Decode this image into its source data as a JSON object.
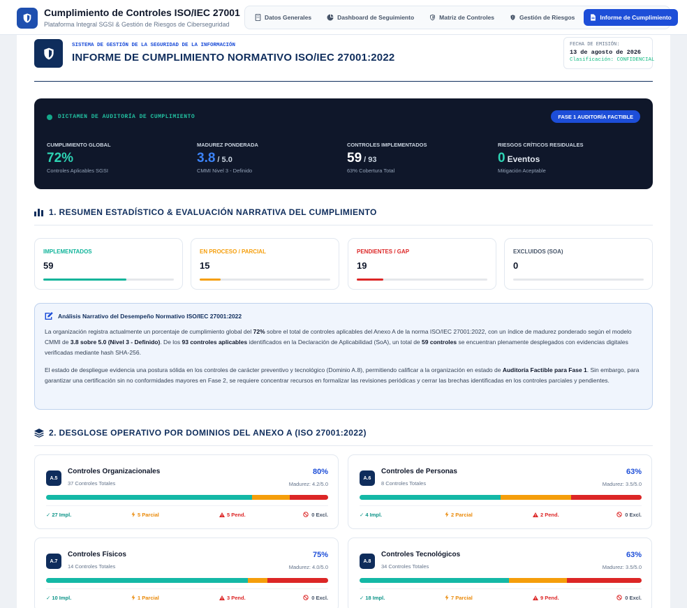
{
  "app": {
    "title": "Cumplimiento de Controles ISO/IEC 27001",
    "subtitle": "Plataforma Integral SGSI & Gestión de Riesgos de Ciberseguridad"
  },
  "nav": [
    {
      "label": "Datos Generales",
      "icon": "building-icon",
      "active": false
    },
    {
      "label": "Dashboard de Seguimiento",
      "icon": "pie-chart-icon",
      "active": false
    },
    {
      "label": "Matriz de Controles",
      "icon": "shield-icon",
      "active": false
    },
    {
      "label": "Gestión de Riesgos",
      "icon": "shield-alert-icon",
      "active": false
    },
    {
      "label": "Informe de Cumplimiento",
      "icon": "document-icon",
      "active": true
    }
  ],
  "report": {
    "kicker": "SISTEMA DE GESTIÓN DE LA SEGURIDAD DE LA INFORMACIÓN",
    "title": "INFORME DE CUMPLIMIENTO NORMATIVO ISO/IEC 27001:2022",
    "emit_label": "FECHA DE EMISIÓN:",
    "emit_date": "13 de agosto de 2026",
    "classification": "Clasificación: CONFIDENCIAL"
  },
  "dictamen": {
    "title": "DICTAMEN DE AUDITORÍA DE CUMPLIMIENTO",
    "badge": "FASE 1 AUDITORÍA FACTIBLE",
    "kpis": [
      {
        "label": "CUMPLIMIENTO GLOBAL",
        "value": "72%",
        "unit": "",
        "sub": "Controles Aplicables SGSI"
      },
      {
        "label": "MADUREZ PONDERADA",
        "value": "3.8",
        "unit": "/ 5.0",
        "sub": "CMMI Nivel 3 - Definido"
      },
      {
        "label": "CONTROLES IMPLEMENTADOS",
        "value": "59",
        "unit": "/ 93",
        "sub": "63% Cobertura Total"
      },
      {
        "label": "RIESGOS CRÍTICOS RESIDUALES",
        "value": "0",
        "unit": "Eventos",
        "sub": "Mitigación Aceptable"
      }
    ]
  },
  "section1": {
    "title": "1. RESUMEN ESTADÍSTICO & EVALUACIÓN NARRATIVA DEL CUMPLIMIENTO",
    "stats": [
      {
        "label": "IMPLEMENTADOS",
        "value": "59",
        "color": "#10b49a",
        "fraction": 0.634
      },
      {
        "label": "EN PROCESO / PARCIAL",
        "value": "15",
        "color": "#f59e0b",
        "fraction": 0.161
      },
      {
        "label": "PENDIENTES / GAP",
        "value": "19",
        "color": "#dc2626",
        "fraction": 0.204
      },
      {
        "label": "EXCLUIDOS (SOA)",
        "value": "0",
        "color": "#475569",
        "fraction": 0
      }
    ],
    "narrative": {
      "title": "Análisis Narrativo del Desempeño Normativo ISO/IEC 27001:2022",
      "p1": [
        {
          "t": "La organización registra actualmente un porcentaje de cumplimiento global del ",
          "b": false
        },
        {
          "t": "72%",
          "b": true
        },
        {
          "t": " sobre el total de controles aplicables del Anexo A de la norma ISO/IEC 27001:2022, con un índice de madurez ponderado según el modelo CMMI de ",
          "b": false
        },
        {
          "t": "3.8 sobre 5.0 (Nivel 3 - Definido)",
          "b": true
        },
        {
          "t": ". De los ",
          "b": false
        },
        {
          "t": "93 controles aplicables",
          "b": true
        },
        {
          "t": " identificados en la Declaración de Aplicabilidad (SoA), un total de ",
          "b": false
        },
        {
          "t": "59 controles",
          "b": true
        },
        {
          "t": " se encuentran plenamente desplegados con evidencias digitales verificadas mediante hash SHA-256.",
          "b": false
        }
      ],
      "p2": [
        {
          "t": "El estado de despliegue evidencia una postura sólida en los controles de carácter preventivo y tecnológico (Dominio A.8), permitiendo calificar a la organización en estado de ",
          "b": false
        },
        {
          "t": "Auditoría Factible para Fase 1",
          "b": true
        },
        {
          "t": ". Sin embargo, para garantizar una certificación sin no conformidades mayores en Fase 2, se requiere concentrar recursos en formalizar las revisiones periódicas y cerrar las brechas identificadas en los controles parciales y pendientes.",
          "b": false
        }
      ]
    }
  },
  "section2": {
    "title": "2. DESGLOSE OPERATIVO POR DOMINIOS DEL ANEXO A (ISO 27001:2022)",
    "domains": [
      {
        "code": "A.5",
        "name": "Controles Organizacionales",
        "total": "37 Controles Totales",
        "pct": "80%",
        "madurez": "Madurez: 4.2/5.0",
        "impl": 27,
        "parc": 5,
        "pend": 5,
        "excl": 0,
        "impl_label": "✓ 27 Impl.",
        "parc_label": "5 Parcial",
        "pend_label": "5 Pend.",
        "excl_label": "0 Excl."
      },
      {
        "code": "A.6",
        "name": "Controles de Personas",
        "total": "8 Controles Totales",
        "pct": "63%",
        "madurez": "Madurez: 3.5/5.0",
        "impl": 4,
        "parc": 2,
        "pend": 2,
        "excl": 0,
        "impl_label": "✓ 4 Impl.",
        "parc_label": "2 Parcial",
        "pend_label": "2 Pend.",
        "excl_label": "0 Excl."
      },
      {
        "code": "A.7",
        "name": "Controles Físicos",
        "total": "14 Controles Totales",
        "pct": "75%",
        "madurez": "Madurez: 4.0/5.0",
        "impl": 10,
        "parc": 1,
        "pend": 3,
        "excl": 0,
        "impl_label": "✓ 10 Impl.",
        "parc_label": "1 Parcial",
        "pend_label": "3 Pend.",
        "excl_label": "0 Excl."
      },
      {
        "code": "A.8",
        "name": "Controles Tecnológicos",
        "total": "34 Controles Totales",
        "pct": "63%",
        "madurez": "Madurez: 3.5/5.0",
        "impl": 18,
        "parc": 7,
        "pend": 9,
        "excl": 0,
        "impl_label": "✓ 18 Impl.",
        "parc_label": "7 Parcial",
        "pend_label": "9 Pend.",
        "excl_label": "0 Excl."
      }
    ]
  }
}
